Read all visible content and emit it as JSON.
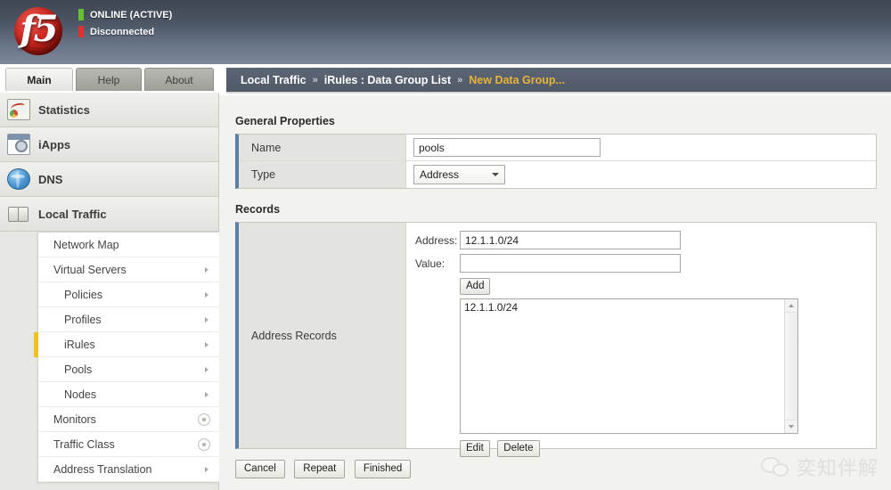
{
  "header": {
    "logo_text": "f5",
    "status": [
      {
        "label": "ONLINE (ACTIVE)",
        "color": "#63c132"
      },
      {
        "label": "Disconnected",
        "color": "#e03030"
      }
    ]
  },
  "tabs": [
    {
      "label": "Main",
      "active": true
    },
    {
      "label": "Help",
      "active": false
    },
    {
      "label": "About",
      "active": false
    }
  ],
  "breadcrumb": {
    "sep": "»",
    "items": [
      "Local Traffic",
      "iRules : Data Group List"
    ],
    "current": "New Data Group..."
  },
  "sidebar": {
    "main_items": [
      {
        "label": "Statistics",
        "icon": "statistics-icon"
      },
      {
        "label": "iApps",
        "icon": "iapps-icon"
      },
      {
        "label": "DNS",
        "icon": "dns-icon"
      },
      {
        "label": "Local Traffic",
        "icon": "local-traffic-icon"
      }
    ],
    "sub_items": [
      {
        "label": "Network Map",
        "chevron": false,
        "indent": false,
        "circle": false,
        "active": false
      },
      {
        "label": "Virtual Servers",
        "chevron": true,
        "indent": false,
        "circle": false,
        "active": false
      },
      {
        "label": "Policies",
        "chevron": true,
        "indent": true,
        "circle": false,
        "active": false
      },
      {
        "label": "Profiles",
        "chevron": true,
        "indent": true,
        "circle": false,
        "active": false
      },
      {
        "label": "iRules",
        "chevron": true,
        "indent": true,
        "circle": false,
        "active": true
      },
      {
        "label": "Pools",
        "chevron": true,
        "indent": true,
        "circle": false,
        "active": false
      },
      {
        "label": "Nodes",
        "chevron": true,
        "indent": true,
        "circle": false,
        "active": false
      },
      {
        "label": "Monitors",
        "chevron": false,
        "indent": false,
        "circle": true,
        "active": false
      },
      {
        "label": "Traffic Class",
        "chevron": false,
        "indent": false,
        "circle": true,
        "active": false
      },
      {
        "label": "Address Translation",
        "chevron": true,
        "indent": false,
        "circle": false,
        "active": false
      }
    ]
  },
  "general_properties": {
    "title": "General Properties",
    "name_label": "Name",
    "name_value": "pools",
    "type_label": "Type",
    "type_value": "Address"
  },
  "records": {
    "title": "Records",
    "left_label": "Address Records",
    "address_label": "Address:",
    "address_value": "12.1.1.0/24",
    "value_label": "Value:",
    "value_value": "",
    "add_label": "Add",
    "list_items": [
      "12.1.1.0/24"
    ],
    "edit_label": "Edit",
    "delete_label": "Delete"
  },
  "bottom_actions": {
    "cancel_label": "Cancel",
    "repeat_label": "Repeat",
    "finished_label": "Finished"
  },
  "watermark": {
    "text": "奕知伴解"
  },
  "colors": {
    "accent_blue": "#5b7fa6",
    "breadcrumb_active": "#e8b33a",
    "online_green": "#63c132",
    "offline_red": "#e03030"
  }
}
